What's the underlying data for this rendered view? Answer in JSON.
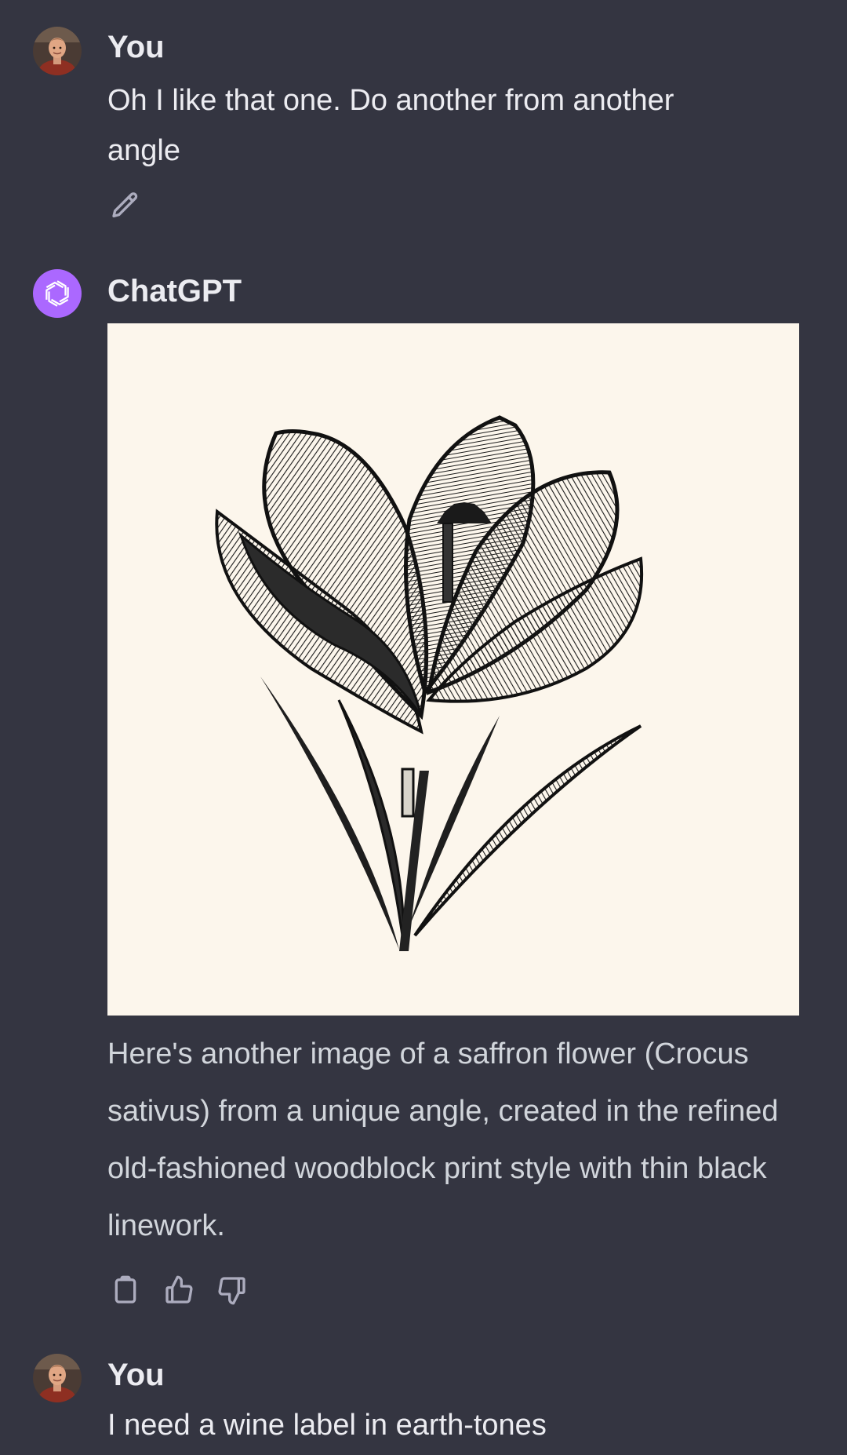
{
  "colors": {
    "background": "#343541",
    "user_text": "#ececf1",
    "assistant_text": "#d1d5db",
    "icon": "#acacbe",
    "assistant_avatar": "#ab68ff",
    "image_background": "#fcf6ec"
  },
  "messages": [
    {
      "role": "user",
      "author": "You",
      "text": "Oh I like that one.  Do another from another angle",
      "actions": [
        "pencil-icon"
      ]
    },
    {
      "role": "assistant",
      "author": "ChatGPT",
      "image": "saffron-flower-woodblock-illustration",
      "text": "Here's another image of a saffron flower (Crocus sativus) from a unique angle, created in the refined old-fashioned woodblock print style with thin black linework.",
      "actions": [
        "clipboard-icon",
        "thumbs-up-icon",
        "thumbs-down-icon"
      ]
    },
    {
      "role": "user",
      "author": "You",
      "text": "I need a wine label in earth-tones"
    }
  ]
}
